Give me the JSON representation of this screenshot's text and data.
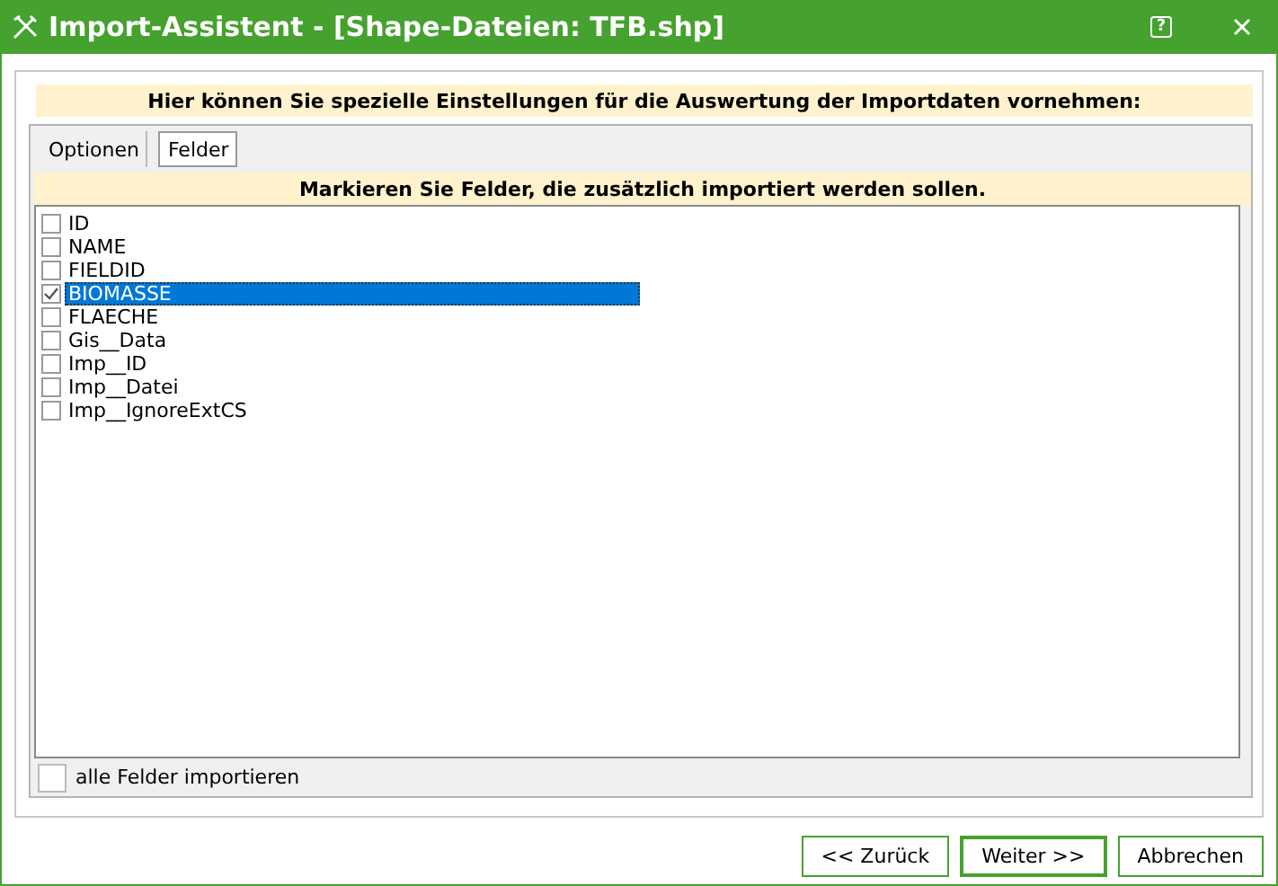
{
  "window": {
    "title": "Import-Assistent - [Shape-Dateien: TFB.shp]",
    "help": "?"
  },
  "header": "Hier können Sie spezielle Einstellungen für die Auswertung der Importdaten vornehmen:",
  "tabs": [
    {
      "label": "Optionen",
      "selected": false
    },
    {
      "label": "Felder",
      "selected": true
    }
  ],
  "list_header": "Markieren Sie Felder, die zusätzlich importiert werden sollen.",
  "fields": [
    {
      "label": "ID",
      "checked": false,
      "selected": false
    },
    {
      "label": "NAME",
      "checked": false,
      "selected": false
    },
    {
      "label": "FIELDID",
      "checked": false,
      "selected": false
    },
    {
      "label": "BIOMASSE",
      "checked": true,
      "selected": true
    },
    {
      "label": "FLAECHE",
      "checked": false,
      "selected": false
    },
    {
      "label": "Gis__Data",
      "checked": false,
      "selected": false
    },
    {
      "label": "Imp__ID",
      "checked": false,
      "selected": false
    },
    {
      "label": "Imp__Datei",
      "checked": false,
      "selected": false
    },
    {
      "label": "Imp__IgnoreExtCS",
      "checked": false,
      "selected": false
    }
  ],
  "all_fields": {
    "label": "alle Felder importieren",
    "checked": false
  },
  "buttons": [
    {
      "label": "<<  Zurück",
      "default": false
    },
    {
      "label": "Weiter  >>",
      "default": true
    },
    {
      "label": "Abbrechen",
      "default": false
    }
  ]
}
